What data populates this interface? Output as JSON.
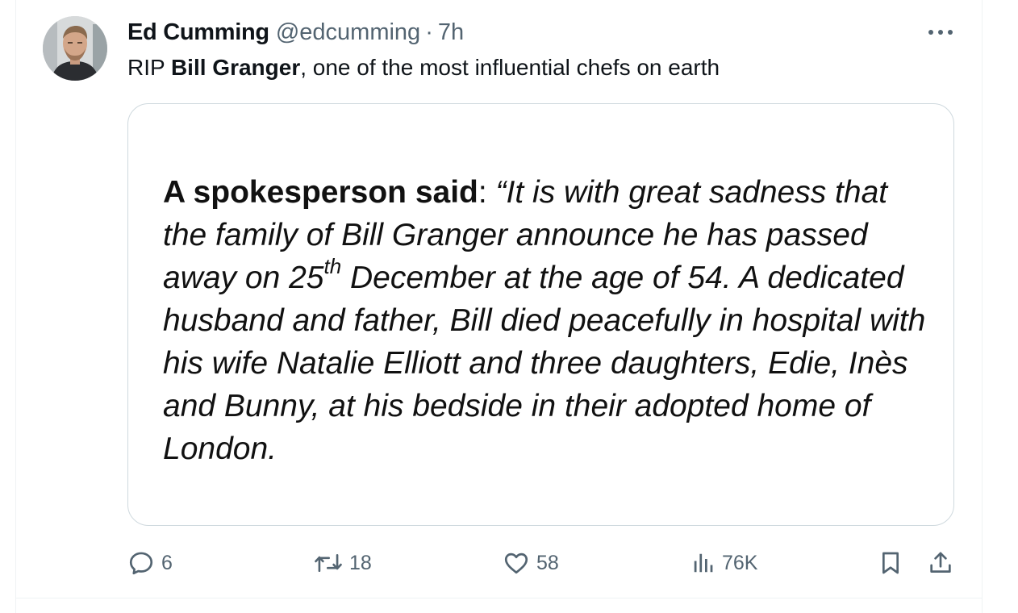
{
  "tweet": {
    "display_name": "Ed Cumming",
    "handle": "@edcumming",
    "separator": "·",
    "time": "7h",
    "text": {
      "prefix": "RIP ",
      "bold": "Bill Granger",
      "suffix": ", one of the most influential chefs on earth"
    }
  },
  "media": {
    "speaker": "A spokesperson said",
    "colon": ":",
    "quote_a": " “It is with great sadness that the family of Bill Granger announce he has passed away on 25",
    "quote_sup": "th",
    "quote_b": " December at the age of 54. A dedicated husband and father, Bill died peacefully in hospital with his wife Natalie Elliott and three daughters, Edie, Inès and Bunny, at his bedside in their adopted home of London."
  },
  "actions": {
    "replies": "6",
    "reposts": "18",
    "likes": "58",
    "views": "76K"
  },
  "colors": {
    "icon_gray": "#536471",
    "border": "#cfd9de",
    "text": "#0f1419"
  },
  "icons": [
    "more-icon",
    "reply-icon",
    "repost-icon",
    "like-icon",
    "views-icon",
    "bookmark-icon",
    "share-icon"
  ]
}
